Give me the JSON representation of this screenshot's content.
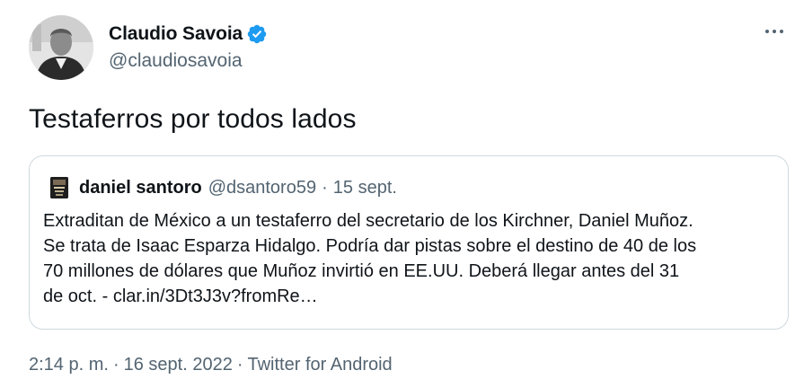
{
  "author": {
    "display_name": "Claudio Savoia",
    "handle": "@claudiosavoia",
    "verified": true,
    "verified_icon": "verified-badge-icon",
    "verified_color": "#1d9bf0"
  },
  "menu": {
    "icon": "more-horizontal-icon"
  },
  "tweet": {
    "text": "Testaferros por todos lados"
  },
  "quote": {
    "display_name": "daniel santoro",
    "handle": "@dsantoro59",
    "separator": "·",
    "date": "15 sept.",
    "lines": [
      "Extraditan de México a un testaferro del secretario de los Kirchner, Daniel Muñoz.",
      "Se trata de Isaac Esparza Hidalgo. Podría dar pistas  sobre el destino de 40 de los",
      "70 millones de dólares que Muñoz invirtió en EE.UU. Deberá llegar antes del 31",
      "de oct. - clar.in/3Dt3J3v?fromRe…"
    ]
  },
  "meta": {
    "time": "2:14 p. m.",
    "separator": "·",
    "date": "16 sept. 2022",
    "source": "Twitter for Android"
  },
  "colors": {
    "text_primary": "#0f1419",
    "text_secondary": "#536471",
    "border": "#cfd9de"
  }
}
